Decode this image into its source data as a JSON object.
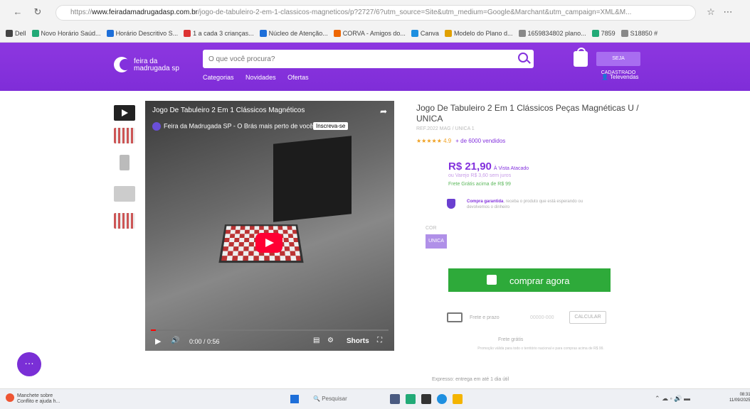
{
  "browser": {
    "url_prefix": "https://",
    "url_domain": "www.feiradamadrugadasp.com.br",
    "url_rest": "/jogo-de-tabuleiro-2-em-1-classicos-magneticos/p?2727/6?utm_source=Site&utm_medium=Google&Marchant&utm_campaign=XML&M...",
    "bookmarks": [
      "Dell",
      "Novo Horário Saúd...",
      "Horário Descritivo S...",
      "1 a cada 3 crianças...",
      "Núcleo de Atenção...",
      "CORVA - Amigos do...",
      "Canva",
      "Modelo do Plano d...",
      "1659834802 plano...",
      "7859",
      "S18850 #"
    ]
  },
  "header": {
    "logo_line1": "feira da",
    "logo_line2": "madrugada sp",
    "search_placeholder": "O que você procura?",
    "nav": [
      "Categorias",
      "Novidades",
      "Ofertas"
    ],
    "seja_button": "SEJA CADASTRADO",
    "televendas": "Televendas"
  },
  "video": {
    "title": "Jogo De Tabuleiro 2 Em 1 Clássicos Magnéticos",
    "channel": "Feira da Madrugada SP - O Brás mais perto de você!",
    "subscribe": "Inscreva-se",
    "time": "0:00 / 0:56",
    "shorts": "Shorts",
    "progress": 0.02
  },
  "product": {
    "title": "Jogo De Tabuleiro 2 Em 1 Clássicos Peças Magnéticas U / UNICA",
    "sku": "REF.2022 MAG / UNICA 1",
    "stars": "★★★★★",
    "rating": "4.9",
    "sold": "+ de 6000 vendidos",
    "price": "R$ 21,90",
    "price_suffix": "À Vista Atacado",
    "price_sub": "ou Varejo R$ 3,60 sem juros",
    "frete": "Frete Grátis acima de R$ 99",
    "guarantee_title": "Compra garantida",
    "guarantee_text": ", receba o produto que está esperando ou devolvemos o dinheiro",
    "color_label": "COR",
    "variant": "UNICA",
    "buy_button": "comprar agora",
    "shipping_label": "Frete e prazo",
    "cep_placeholder": "00000-000",
    "calc_button": "CALCULAR",
    "free_shipping": "Frete grátis",
    "free_fine": "Promoção válida para todo o território nacional e para compras acima de R$ 99.",
    "expresso": "Expresso: entrega em até 1 dia útil"
  },
  "taskbar": {
    "weather_line1": "Manchete sobre",
    "weather_line2": "Conflito e ajuda h...",
    "search": "Pesquisar",
    "time": "08:31",
    "date": "11/09/2025"
  }
}
